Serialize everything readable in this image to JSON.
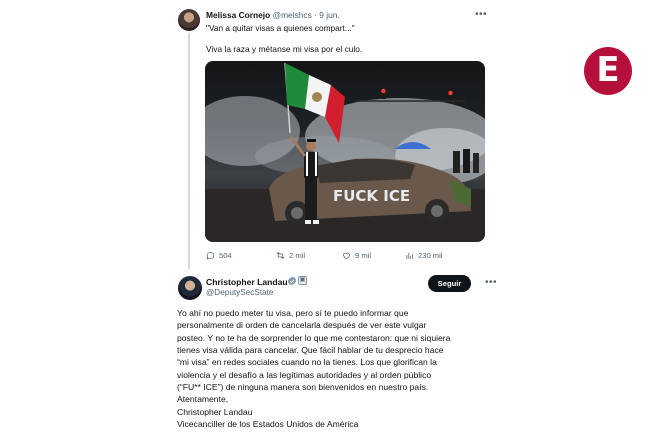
{
  "colors": {
    "accent_logo": "#b5103c",
    "text_primary": "#0f1419",
    "text_secondary": "#536471",
    "follow_button": "#0f1419"
  },
  "logo": {
    "letter": "E"
  },
  "tweet1": {
    "author_name": "Melissa Cornejo",
    "meta": "@melshcs · 9 jun.",
    "quote_line": "\"Van a quitar visas a quienes compart...\"",
    "text": "Viva la raza y métanse mi visa por el culo.",
    "image_text": "FUCK ICE",
    "icons": [
      "avatar",
      "more-icon",
      "reply-icon",
      "retweet-icon",
      "like-icon",
      "views-icon"
    ],
    "actions": {
      "replies": "504",
      "retweets": "2 mil",
      "likes": "9 mil",
      "views": "230 mil"
    }
  },
  "tweet2": {
    "author_name": "Christopher Landau",
    "handle": "@DeputySecState",
    "gov_badge": "▣",
    "follow_label": "Seguir",
    "body_lines": [
      "Yo ahí no puedo meter tu visa, pero sí te puedo informar que",
      "personalmente di orden de cancelarla después de ver este vulgar",
      "posteo. Y no te ha de sorprender lo que me contestaron: que ni siquiera",
      "tienes visa válida para cancelar. Que fácil hablar de tu desprecio hace",
      "“mi visa” en redes sociales cuando no la tienes. Los que glorifican la",
      "violencia y el desafío a las legítimas autoridades y al orden público",
      "(“FU** ICE”) de ninguna manera son bienvenidos en nuestro país.",
      "Atentamente,",
      "Christopher Landau",
      "Vicecanciller de los Estados Unidos de América"
    ]
  }
}
